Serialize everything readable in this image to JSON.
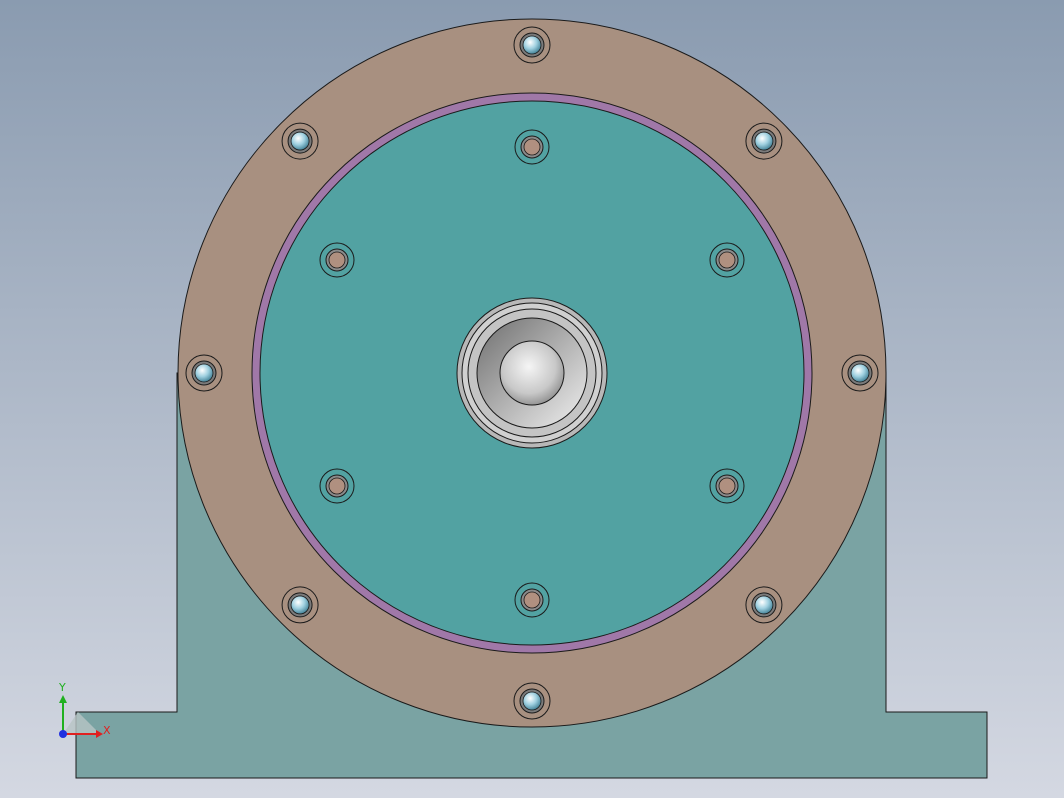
{
  "colors": {
    "background_top": "#8a9bb0",
    "background_bottom": "#d4d8e2",
    "housing": "#7aa3a3",
    "flange": "#a89080",
    "seal_ring": "#a078a8",
    "cover_plate": "#52a2a2",
    "bearing": "#b8b8b8",
    "outline": "#1a1a1a",
    "axis_x": "#e02020",
    "axis_y": "#20b020",
    "axis_z": "#2030e0"
  },
  "triad": {
    "x_label": "X",
    "y_label": "Y"
  }
}
